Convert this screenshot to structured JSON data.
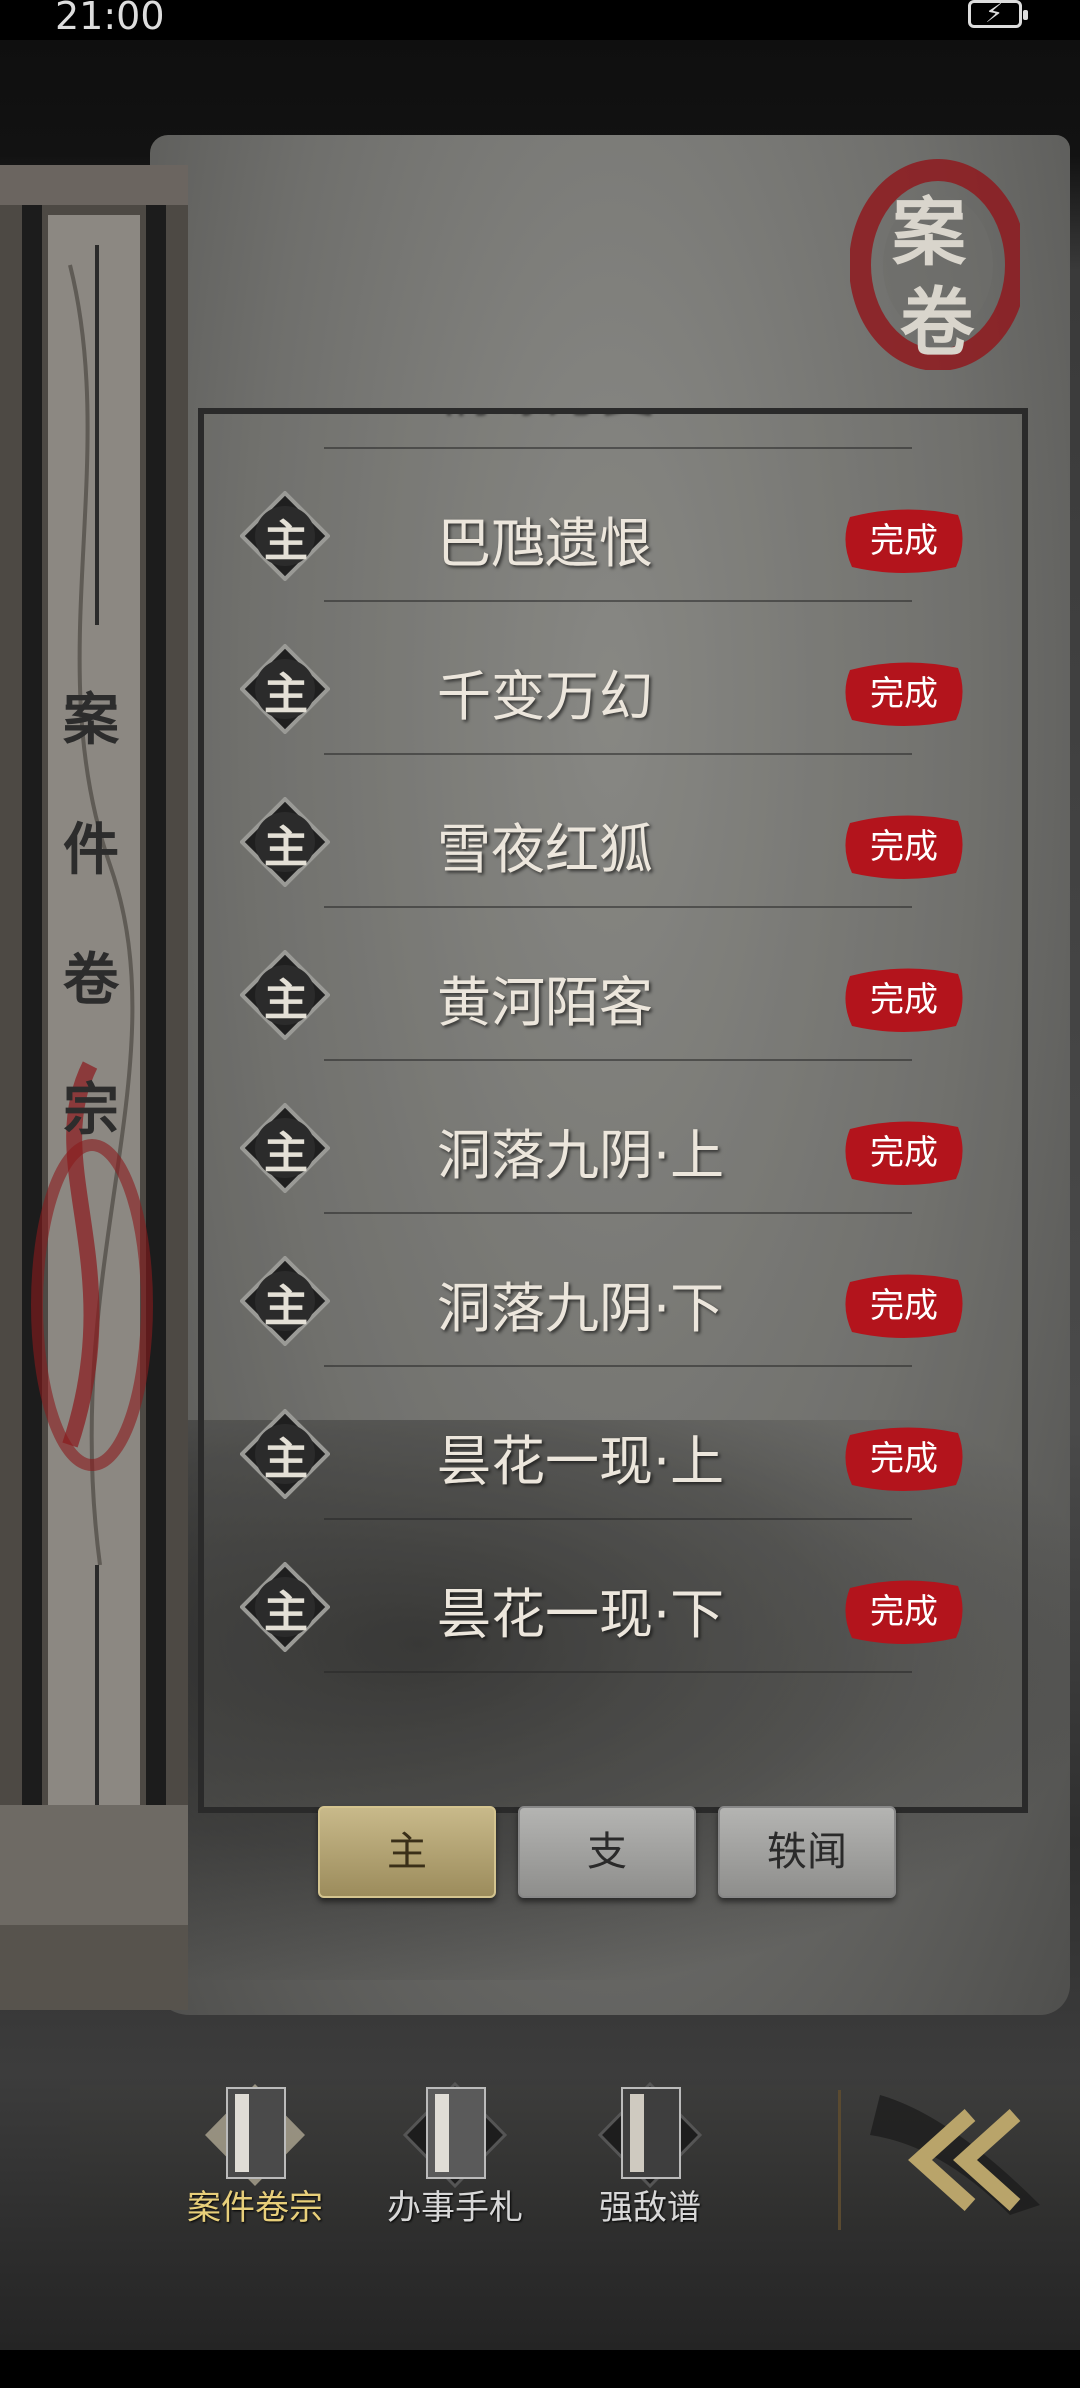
{
  "status_bar": {
    "time": "21:00"
  },
  "header": {
    "seal_text": [
      "案",
      "卷"
    ]
  },
  "sidebar": {
    "title_chars": [
      "案",
      "件",
      "卷",
      "宗"
    ]
  },
  "case_list": {
    "partial_top_name": "情缘万变",
    "items": [
      {
        "name": "巴虺遗恨",
        "type_badge": "主",
        "status": "完成"
      },
      {
        "name": "千变万幻",
        "type_badge": "主",
        "status": "完成"
      },
      {
        "name": "雪夜红狐",
        "type_badge": "主",
        "status": "完成"
      },
      {
        "name": "黄河陌客",
        "type_badge": "主",
        "status": "完成"
      },
      {
        "name": "洞落九阴·上",
        "type_badge": "主",
        "status": "完成"
      },
      {
        "name": "洞落九阴·下",
        "type_badge": "主",
        "status": "完成"
      },
      {
        "name": "昙花一现·上",
        "type_badge": "主",
        "status": "完成"
      },
      {
        "name": "昙花一现·下",
        "type_badge": "主",
        "status": "完成"
      }
    ]
  },
  "tabs": [
    {
      "label": "主",
      "active": true
    },
    {
      "label": "支",
      "active": false
    },
    {
      "label": "轶闻",
      "active": false
    }
  ],
  "bottom_nav": [
    {
      "label": "案件卷宗",
      "active": true
    },
    {
      "label": "办事手札",
      "active": false
    },
    {
      "label": "强敌谱",
      "active": false
    }
  ],
  "colors": {
    "stamp_red": "#b3141c",
    "active_gold": "#e8cf7a",
    "tab_gold": "#c8b98a"
  }
}
